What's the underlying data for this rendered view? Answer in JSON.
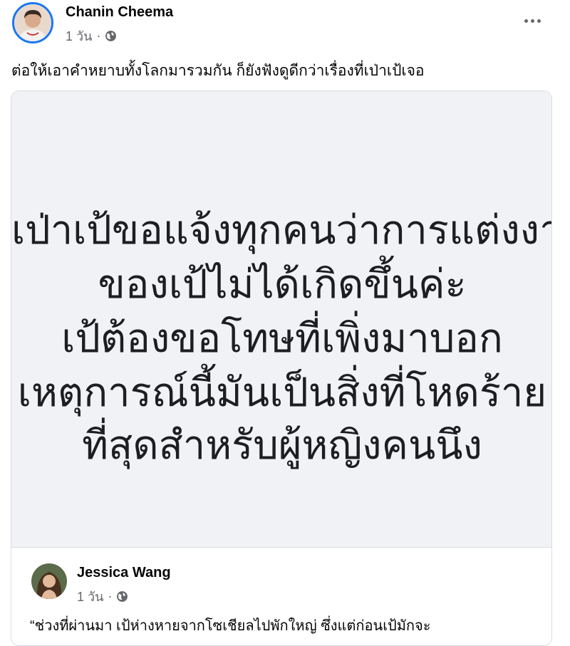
{
  "post": {
    "author": "Chanin Cheema",
    "time": "1 วัน",
    "dot": "·",
    "more_icon": "more-horizontal-icon",
    "caption": "ต่อให้เอาคำหยาบทั้งโลกมารวมกัน ก็ยังฟังดูดีกว่าเรื่องที่เป่าเป้เจอ"
  },
  "shared_post": {
    "statement_lines": [
      "เป่าเป้ขอแจ้งทุกคนว่าการแต่งงาน",
      "ของเป้ไม่ได้เกิดขึ้นค่ะ",
      "เป้ต้องขอโทษที่เพิ่งมาบอก",
      "เหตุการณ์นี้มันเป็นสิ่งที่โหดร้าย",
      "ที่สุดสำหรับผู้หญิงคนนึง"
    ],
    "author": "Jessica Wang",
    "time": "1 วัน",
    "dot": "·",
    "body_preview": "“ช่วงที่ผ่านมา เป้ห่างหายจากโซเชียลไปพักใหญ่ ซึ่งแต่ก่อนเป้มักจะ"
  },
  "colors": {
    "accent": "#1877f2",
    "meta_text": "#65676b",
    "card_background": "#f0f2f5",
    "border": "#dadde1"
  },
  "icons": {
    "privacy": "globe-icon"
  }
}
